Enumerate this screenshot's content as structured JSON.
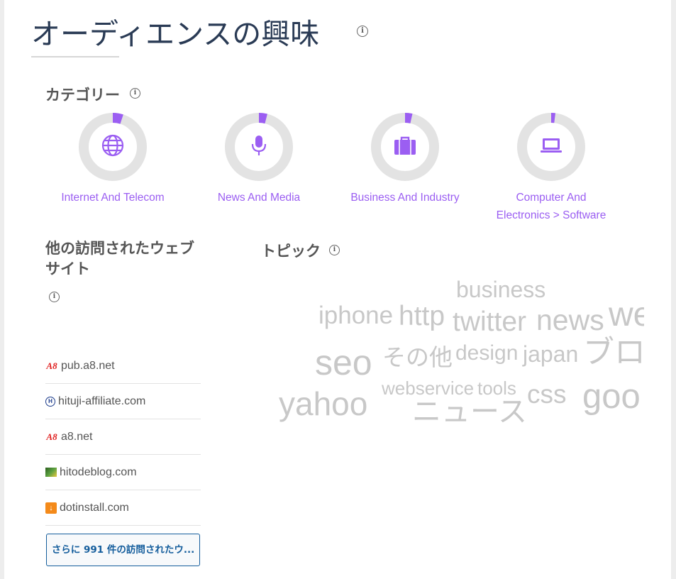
{
  "page": {
    "title": "オーディエンスの興味"
  },
  "categories": {
    "heading": "カテゴリー",
    "items": [
      {
        "label": "Internet And Telecom",
        "share": 0.05,
        "icon": "globe-icon"
      },
      {
        "label": "News And Media",
        "share": 0.04,
        "icon": "microphone-icon"
      },
      {
        "label": "Business And Industry",
        "share": 0.035,
        "icon": "briefcase-icon"
      },
      {
        "label_line1": "Computer And",
        "label_line2": "Electronics > Software",
        "share": 0.02,
        "icon": "laptop-icon"
      }
    ],
    "colors": {
      "accent": "#9b5ef2",
      "track": "#e3e3e3"
    }
  },
  "other_sites": {
    "heading": "他の訪問されたウェブサイト",
    "items": [
      {
        "domain": "pub.a8.net",
        "icon": "a8-favicon"
      },
      {
        "domain": "hituji-affiliate.com",
        "icon": "hituji-favicon"
      },
      {
        "domain": "a8.net",
        "icon": "a8-favicon"
      },
      {
        "domain": "hitodeblog.com",
        "icon": "hitodeblog-favicon"
      },
      {
        "domain": "dotinstall.com",
        "icon": "dotinstall-favicon"
      }
    ],
    "more_button": "さらに 991 件の訪問されたウ..."
  },
  "topics": {
    "heading": "トピック",
    "words": [
      "business",
      "iphone",
      "http",
      "twitter",
      "news",
      "we",
      "seo",
      "その他",
      "design",
      "japan",
      "ブロ",
      "yahoo",
      "webservice",
      "tools",
      "ニュース",
      "css",
      "goo"
    ]
  }
}
